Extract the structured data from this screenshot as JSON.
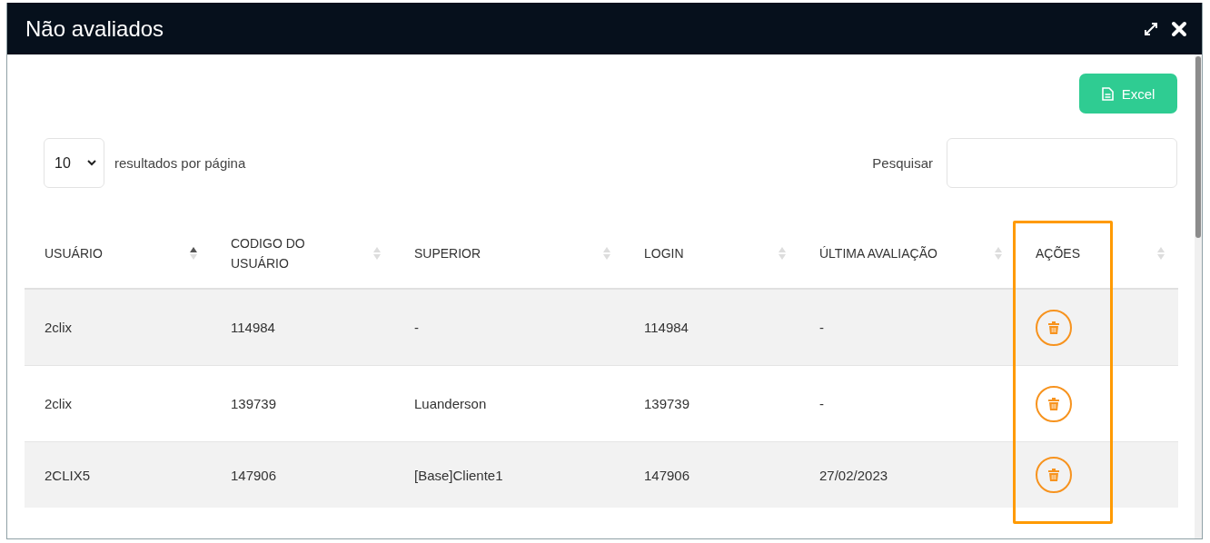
{
  "window": {
    "title": "Não avaliados"
  },
  "toolbar": {
    "export_button": "Excel"
  },
  "page_size": {
    "value": "10",
    "label": "resultados por página"
  },
  "search": {
    "label": "Pesquisar"
  },
  "table": {
    "columns": [
      {
        "label": "USUÁRIO",
        "sorted": true,
        "highlighted": false
      },
      {
        "label": "CODIGO DO USUÁRIO",
        "sorted": false,
        "highlighted": false
      },
      {
        "label": "SUPERIOR",
        "sorted": false,
        "highlighted": false
      },
      {
        "label": "LOGIN",
        "sorted": false,
        "highlighted": false
      },
      {
        "label": "ÚLTIMA AVALIAÇÃO",
        "sorted": false,
        "highlighted": false
      },
      {
        "label": "AÇÕES",
        "sorted": false,
        "highlighted": true
      }
    ],
    "rows": [
      {
        "cells": [
          "2clix",
          "114984",
          "-",
          "114984",
          "-"
        ]
      },
      {
        "cells": [
          "2clix",
          "139739",
          "Luanderson",
          "139739",
          "-"
        ]
      },
      {
        "cells": [
          "2CLIX5",
          "147906",
          "[Base]Cliente1",
          "147906",
          "27/02/2023"
        ]
      }
    ]
  }
}
